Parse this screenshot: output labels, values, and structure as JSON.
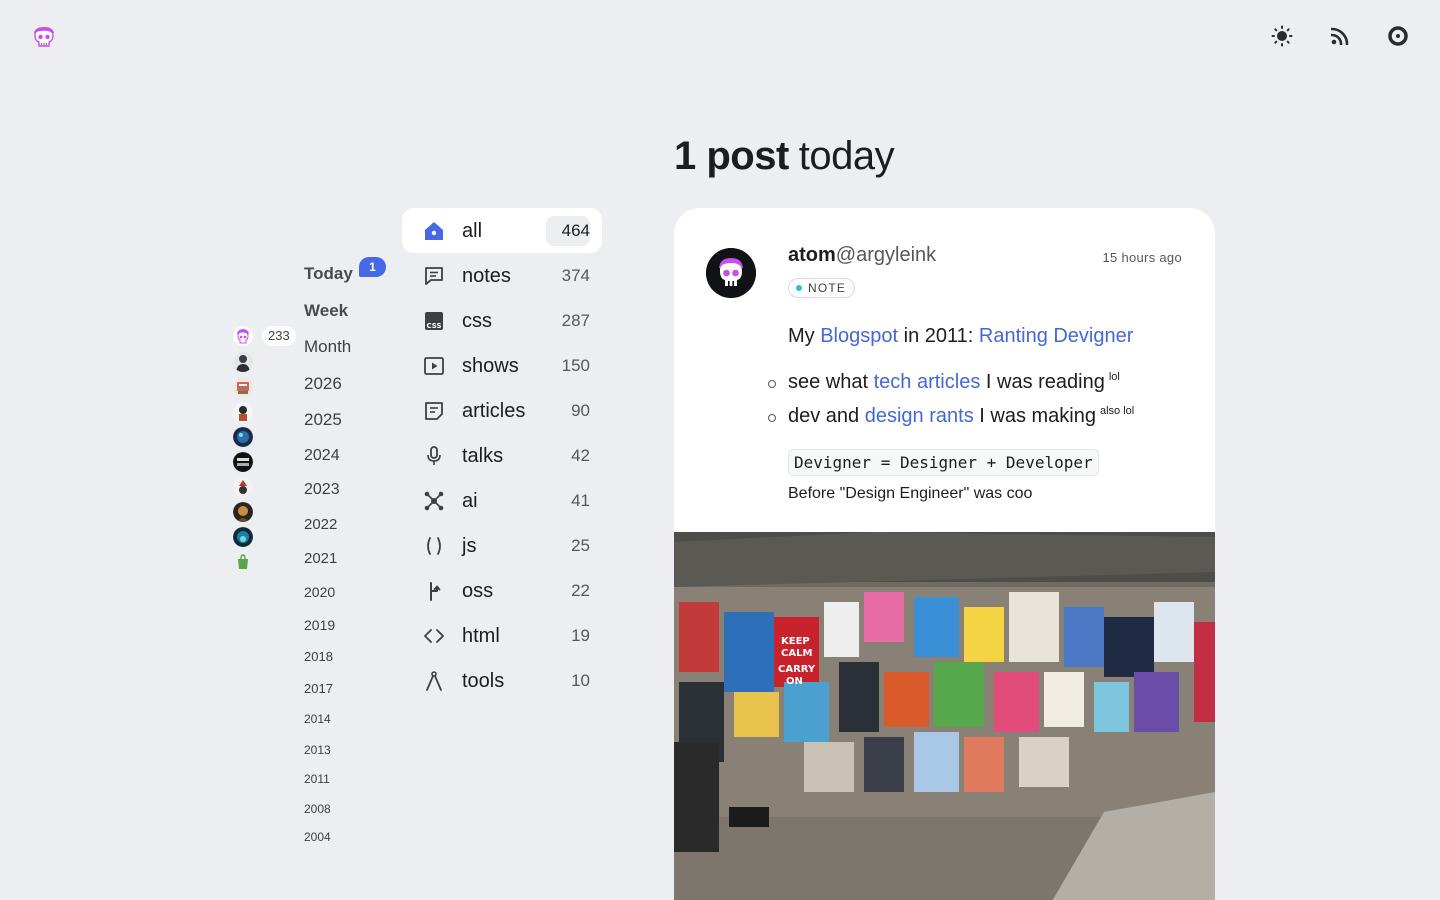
{
  "header": {
    "logo_icon": "skull-logo-icon",
    "actions": [
      {
        "name": "theme-toggle",
        "icon": "sun-icon"
      },
      {
        "name": "rss-feed",
        "icon": "rss-icon"
      },
      {
        "name": "github",
        "icon": "circle-icon"
      }
    ]
  },
  "page": {
    "post_count": "1 post",
    "period": "today"
  },
  "avatars": {
    "count": "233"
  },
  "time_filter": {
    "today_badge": "1",
    "items": [
      "Today",
      "Week",
      "Month",
      "2026",
      "2025",
      "2024",
      "2023",
      "2022",
      "2021",
      "2020",
      "2019",
      "2018",
      "2017",
      "2014",
      "2013",
      "2011",
      "2008",
      "2004"
    ]
  },
  "tags": [
    {
      "label": "all",
      "count": "464",
      "icon": "home-icon"
    },
    {
      "label": "notes",
      "count": "374",
      "icon": "chat-icon"
    },
    {
      "label": "css",
      "count": "287",
      "icon": "css-icon"
    },
    {
      "label": "shows",
      "count": "150",
      "icon": "play-icon"
    },
    {
      "label": "articles",
      "count": "90",
      "icon": "article-icon"
    },
    {
      "label": "talks",
      "count": "42",
      "icon": "mic-icon"
    },
    {
      "label": "ai",
      "count": "41",
      "icon": "network-icon"
    },
    {
      "label": "js",
      "count": "25",
      "icon": "braces-icon"
    },
    {
      "label": "oss",
      "count": "22",
      "icon": "branch-icon"
    },
    {
      "label": "html",
      "count": "19",
      "icon": "code-icon"
    },
    {
      "label": "tools",
      "count": "10",
      "icon": "compass-icon"
    }
  ],
  "post": {
    "author_name": "atom",
    "author_handle": "@argyleink",
    "time_ago": "15 hours ago",
    "type": "NOTE",
    "intro_prefix": "My ",
    "intro_link1": "Blogspot",
    "intro_mid": " in 2011: ",
    "intro_link2": "Ranting Devigner",
    "bullet1_prefix": "see what ",
    "bullet1_link": "tech articles",
    "bullet1_suffix": " I was reading",
    "bullet1_sup": "lol",
    "bullet2_prefix": "dev and ",
    "bullet2_link": "design rants",
    "bullet2_suffix": " I was making",
    "bullet2_sup": "also lol",
    "code": "Devigner = Designer + Developer",
    "caption": "Before \"Design Engineer\" was coo"
  },
  "colors": {
    "background": "#eceef1",
    "accent": "#4468e6",
    "link": "#4468d6"
  }
}
